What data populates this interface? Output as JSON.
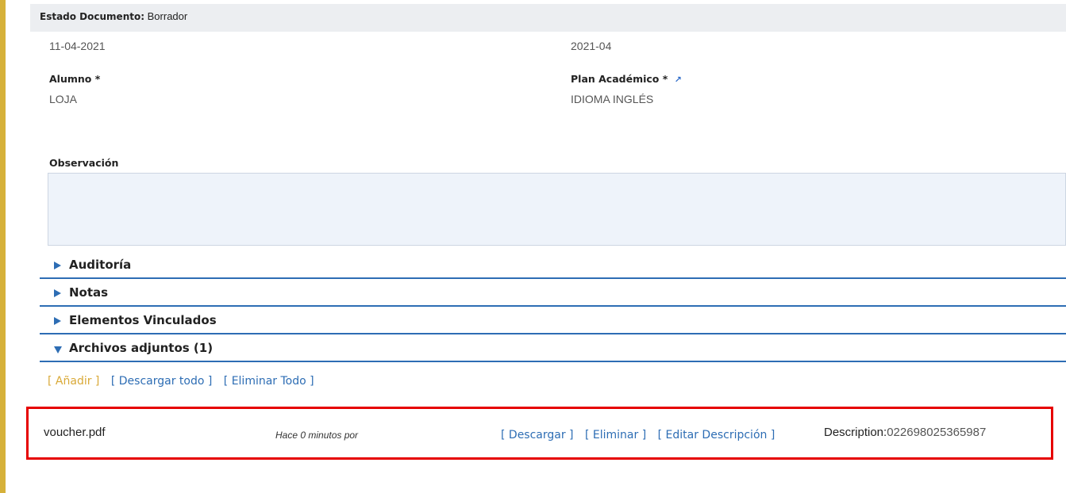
{
  "status": {
    "label": "Estado Documento:",
    "value": "Borrador"
  },
  "fields": {
    "date": "11-04-2021",
    "period": "2021-04",
    "student_label": "Alumno *",
    "student_value": "LOJA",
    "plan_label": "Plan Académico *",
    "plan_value": "IDIOMA INGLÉS",
    "observation_label": "Observación"
  },
  "sections": [
    {
      "title": "Auditoría"
    },
    {
      "title": "Notas"
    },
    {
      "title": "Elementos Vinculados"
    },
    {
      "title": "Archivos adjuntos (1)"
    }
  ],
  "attachments_actions": {
    "add": "[ Añadir ]",
    "download_all": "[ Descargar todo ]",
    "delete_all": "[ Eliminar Todo ]"
  },
  "file": {
    "name": "voucher.pdf",
    "time": "Hace 0 minutos por",
    "download": "[ Descargar ]",
    "delete": "[ Eliminar ]",
    "edit_description": "[ Editar Descripción ]",
    "description_label": "Description:",
    "description_value": "022698025365987"
  },
  "colors": {
    "accent_bar": "#d6b13a",
    "link": "#2d6db4",
    "add": "#d9a937",
    "highlight": "#e60000"
  }
}
